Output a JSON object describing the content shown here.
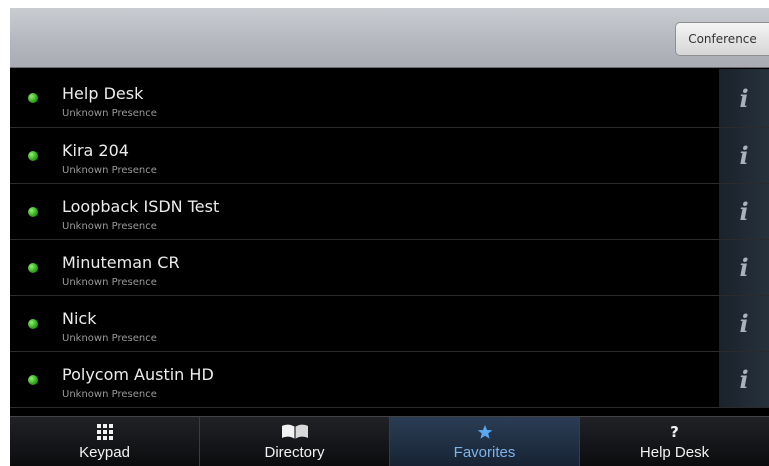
{
  "header": {
    "conference_label": "Conference"
  },
  "contacts": [
    {
      "name": "Help Desk",
      "presence": "Unknown Presence"
    },
    {
      "name": "Kira 204",
      "presence": "Unknown Presence"
    },
    {
      "name": "Loopback ISDN Test",
      "presence": "Unknown Presence"
    },
    {
      "name": "Minuteman CR",
      "presence": "Unknown Presence"
    },
    {
      "name": "Nick",
      "presence": "Unknown Presence"
    },
    {
      "name": "Polycom Austin HD",
      "presence": "Unknown Presence"
    }
  ],
  "info_glyph": "i",
  "tabs": [
    {
      "label": "Keypad",
      "icon": "keypad-icon",
      "active": false
    },
    {
      "label": "Directory",
      "icon": "book-icon",
      "active": false
    },
    {
      "label": "Favorites",
      "icon": "star-icon",
      "active": true
    },
    {
      "label": "Help Desk",
      "icon": "?",
      "active": false
    }
  ],
  "colors": {
    "presence_dot": "#3fbf2a",
    "active_tab_text": "#7db2ea",
    "background": "#000000"
  }
}
